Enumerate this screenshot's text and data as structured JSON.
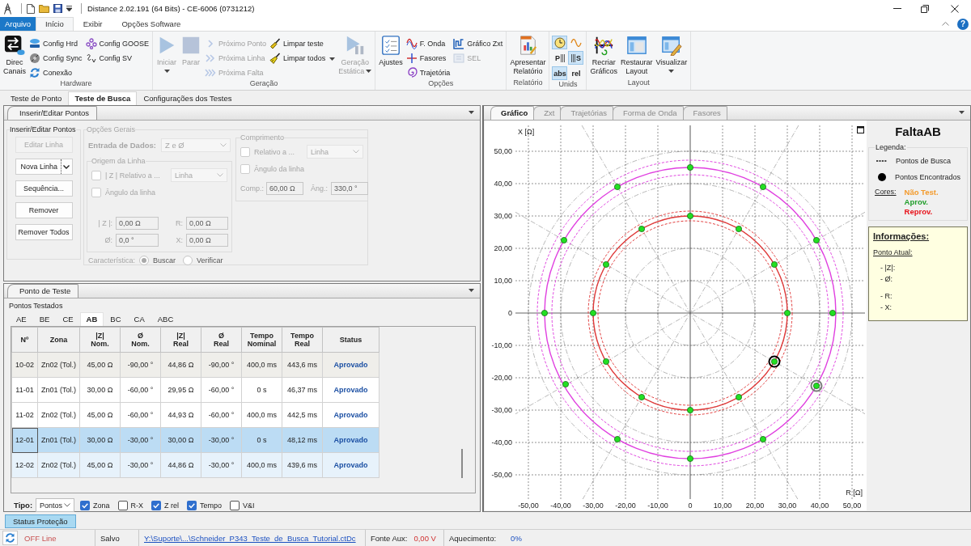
{
  "title_bar": {
    "title": "Distance 2.02.191 (64 Bits) - CE-6006 (0731212)"
  },
  "menu_bar": {
    "tabs": [
      {
        "label": "Arquivo",
        "kind": "file",
        "selected": false
      },
      {
        "label": "Início",
        "kind": "tab",
        "selected": true
      },
      {
        "label": "Exibir",
        "kind": "tab",
        "selected": false
      },
      {
        "label": "Opções Software",
        "kind": "tab",
        "selected": false
      }
    ],
    "help": "?"
  },
  "ribbon": [
    {
      "label": "Hardware",
      "columns": [
        {
          "kind": "large",
          "items": [
            {
              "label": "Direc\nCanais",
              "disabled": false
            }
          ]
        },
        {
          "kind": "stack",
          "items": [
            {
              "label": "Config Hrd",
              "disabled": false
            },
            {
              "label": "Config Sync",
              "disabled": false
            },
            {
              "label": "Conexão",
              "disabled": false
            }
          ]
        },
        {
          "kind": "stack",
          "items": [
            {
              "label": "Config GOOSE",
              "disabled": false
            },
            {
              "label": "Config SV",
              "disabled": false
            }
          ]
        }
      ]
    },
    {
      "label": "Geração",
      "columns": [
        {
          "kind": "large",
          "items": [
            {
              "label": "Iniciar",
              "disabled": true,
              "dropdown": true
            }
          ]
        },
        {
          "kind": "large",
          "items": [
            {
              "label": "Parar",
              "disabled": true
            }
          ]
        },
        {
          "kind": "stack",
          "items": [
            {
              "label": "Próximo Ponto",
              "disabled": true
            },
            {
              "label": "Próxima Linha",
              "disabled": true
            },
            {
              "label": "Próxima Falta",
              "disabled": true
            }
          ]
        },
        {
          "kind": "stack",
          "items": [
            {
              "label": "Limpar teste",
              "disabled": false
            },
            {
              "label": "Limpar todos",
              "disabled": false,
              "dropdown": true
            }
          ]
        },
        {
          "kind": "large",
          "items": [
            {
              "label": "Geração\nEstática",
              "disabled": true,
              "dropdown": true
            }
          ]
        }
      ]
    },
    {
      "label": "Opções",
      "columns": [
        {
          "kind": "large",
          "items": [
            {
              "label": "Ajustes",
              "disabled": false
            }
          ]
        },
        {
          "kind": "stack",
          "items": [
            {
              "label": "F. Onda",
              "disabled": false
            },
            {
              "label": "Fasores",
              "disabled": false
            },
            {
              "label": "Trajetória",
              "disabled": false
            }
          ]
        },
        {
          "kind": "stack",
          "items": [
            {
              "label": "Gráfico Zxt",
              "disabled": false
            },
            {
              "label": "SEL",
              "disabled": true
            }
          ]
        }
      ]
    },
    {
      "label": "Relatório",
      "columns": [
        {
          "kind": "large",
          "items": [
            {
              "label": "Apresentar\nRelatório",
              "disabled": false
            }
          ]
        }
      ]
    },
    {
      "label": "Unids",
      "columns": [
        {
          "kind": "toggles",
          "items": [
            {
              "selected": true
            },
            {
              "selected": false
            },
            {
              "label": "P",
              "selected": false
            },
            {
              "label": "S",
              "selected": true
            },
            {
              "label": "abs",
              "selected": true
            },
            {
              "label": "rel",
              "selected": false
            }
          ]
        }
      ]
    },
    {
      "label": "Layout",
      "columns": [
        {
          "kind": "large",
          "items": [
            {
              "label": "Recriar\nGráficos",
              "disabled": false
            }
          ]
        },
        {
          "kind": "large",
          "items": [
            {
              "label": "Restaurar\nLayout",
              "disabled": false
            }
          ]
        },
        {
          "kind": "large",
          "items": [
            {
              "label": "Visualizar",
              "disabled": false,
              "dropdown": true
            }
          ]
        }
      ]
    }
  ],
  "main_tabs": [
    {
      "label": "Teste de Ponto",
      "selected": false
    },
    {
      "label": "Teste de Busca",
      "selected": true
    },
    {
      "label": "Configurações dos Testes",
      "selected": false
    }
  ],
  "insert_panel": {
    "tab": "Inserir/Editar Pontos",
    "actions": {
      "label": "Inserir/Editar Pontos",
      "buttons": [
        {
          "label": "Editar Linha",
          "kind": "button",
          "disabled": true
        },
        {
          "label": "Nova Linha",
          "kind": "split",
          "disabled": false
        },
        {
          "label": "Sequência...",
          "kind": "button",
          "disabled": false
        },
        {
          "label": "Remover",
          "kind": "button",
          "disabled": false
        },
        {
          "label": "Remover Todos",
          "kind": "button",
          "disabled": false
        }
      ]
    },
    "options": {
      "label": "Opções Gerais",
      "disabled": true,
      "data_entry": {
        "label": "Entrada de Dados:",
        "value": "Z e Ø"
      },
      "origin": {
        "label": "Origem da Linha",
        "checks": [
          {
            "label": "| Z | Relativo a ...",
            "checked": false,
            "select": "Linha"
          },
          {
            "label": "Ângulo da linha",
            "checked": false
          }
        ],
        "fields": [
          {
            "label": "| Z |:",
            "value": "0,00 Ω"
          },
          {
            "label": "R:",
            "value": "0,00 Ω"
          },
          {
            "label": "Ø:",
            "value": "0,0 °"
          },
          {
            "label": "X:",
            "value": "0,00 Ω"
          }
        ]
      },
      "length": {
        "label": "Comprimento",
        "checks": [
          {
            "label": "Relativo a ...",
            "checked": false,
            "select": "Linha"
          },
          {
            "label": "Ângulo da linha",
            "checked": false
          }
        ],
        "fields": [
          {
            "label": "Comp.:",
            "value": "60,00 Ω"
          },
          {
            "label": "Âng.:",
            "value": "330,0 °"
          }
        ]
      },
      "characteristic": {
        "label": "Característica:",
        "options": [
          {
            "label": "Buscar",
            "selected": true
          },
          {
            "label": "Verificar",
            "selected": false
          }
        ]
      }
    }
  },
  "test_panel": {
    "tab": "Ponto de Teste",
    "title": "Pontos Testados",
    "fault_tabs": [
      {
        "label": "AE",
        "selected": false
      },
      {
        "label": "BE",
        "selected": false
      },
      {
        "label": "CE",
        "selected": false
      },
      {
        "label": "AB",
        "selected": true
      },
      {
        "label": "BC",
        "selected": false
      },
      {
        "label": "CA",
        "selected": false
      },
      {
        "label": "ABC",
        "selected": false
      }
    ],
    "table": {
      "columns": [
        "Nº",
        "Zona",
        "|Z|\nNom.",
        "Ø\nNom.",
        "|Z|\nReal",
        "Ø\nReal",
        "Tempo\nNominal",
        "Tempo\nReal",
        "Status"
      ],
      "rows": [
        {
          "cells": [
            "10-02",
            "Zn02 (Tol.)",
            "45,00 Ω",
            "-90,00 °",
            "44,86 Ω",
            "-90,00 °",
            "400,0 ms",
            "443,6 ms",
            "Aprovado"
          ],
          "selected": false,
          "hovered": false,
          "shaded": true
        },
        {
          "cells": [
            "11-01",
            "Zn01 (Tol.)",
            "30,00 Ω",
            "-60,00 °",
            "29,95 Ω",
            "-60,00 °",
            "0 s",
            "46,37 ms",
            "Aprovado"
          ],
          "selected": false,
          "hovered": false,
          "shaded": false
        },
        {
          "cells": [
            "11-02",
            "Zn02 (Tol.)",
            "45,00 Ω",
            "-60,00 °",
            "44,93 Ω",
            "-60,00 °",
            "400,0 ms",
            "442,5 ms",
            "Aprovado"
          ],
          "selected": false,
          "hovered": false,
          "shaded": false
        },
        {
          "cells": [
            "12-01",
            "Zn01 (Tol.)",
            "30,00 Ω",
            "-30,00 °",
            "30,00 Ω",
            "-30,00 °",
            "0 s",
            "48,12 ms",
            "Aprovado"
          ],
          "selected": true,
          "hovered": false,
          "shaded": false
        },
        {
          "cells": [
            "12-02",
            "Zn02 (Tol.)",
            "45,00 Ω",
            "-30,00 °",
            "44,86 Ω",
            "-30,00 °",
            "400,0 ms",
            "439,6 ms",
            "Aprovado"
          ],
          "selected": false,
          "hovered": true,
          "shaded": false
        }
      ]
    },
    "filter": {
      "label": "Tipo:",
      "value": "Pontos",
      "checks": [
        {
          "label": "Zona",
          "checked": true
        },
        {
          "label": "R-X",
          "checked": false
        },
        {
          "label": "Z rel",
          "checked": true
        },
        {
          "label": "Tempo",
          "checked": true
        },
        {
          "label": "V&I",
          "checked": false
        }
      ]
    }
  },
  "graph_panel": {
    "tabs": [
      {
        "label": "Gráfico",
        "selected": true
      },
      {
        "label": "Zxt",
        "selected": false
      },
      {
        "label": "Trajetórias",
        "selected": false
      },
      {
        "label": "Forma de Onda",
        "selected": false
      },
      {
        "label": "Fasores",
        "selected": false
      }
    ],
    "chart_data": {
      "type": "scatter",
      "xlabel": "R [Ω]",
      "ylabel": "X [Ω]",
      "xlim": [
        -54,
        54
      ],
      "ylim": [
        -57.5,
        58
      ],
      "grid": true,
      "xticks": [
        {
          "value": -50,
          "label": "-50,00"
        },
        {
          "value": -40,
          "label": "-40,00"
        },
        {
          "value": -30,
          "label": "-30,00"
        },
        {
          "value": -20,
          "label": "-20,00"
        },
        {
          "value": -10,
          "label": "-10,00"
        },
        {
          "value": 0,
          "label": "0"
        },
        {
          "value": 10,
          "label": "10,00"
        },
        {
          "value": 20,
          "label": "20,00"
        },
        {
          "value": 30,
          "label": "30,00"
        },
        {
          "value": 40,
          "label": "40,00"
        },
        {
          "value": 50,
          "label": "50,00"
        }
      ],
      "yticks": [
        {
          "value": 50,
          "label": "50,00"
        },
        {
          "value": 40,
          "label": "40,00"
        },
        {
          "value": 30,
          "label": "30,00"
        },
        {
          "value": 20,
          "label": "20,00"
        },
        {
          "value": 10,
          "label": "10,00"
        },
        {
          "value": 0,
          "label": "0"
        },
        {
          "value": -10,
          "label": "-10,00"
        },
        {
          "value": -20,
          "label": "-20,00"
        },
        {
          "value": -30,
          "label": "-30,00"
        },
        {
          "value": -40,
          "label": "-40,00"
        },
        {
          "value": -50,
          "label": "-50,00"
        }
      ],
      "x": [
        0,
        15,
        26,
        30,
        26,
        15,
        0,
        -15,
        -26,
        -30,
        -26,
        -15,
        0,
        22.5,
        39,
        44,
        39,
        22.5,
        0,
        -22.5,
        -38.5,
        -45,
        -39,
        -22.5
      ],
      "series": [
        {
          "name": "Pontos Encontrados",
          "color": "#22e022",
          "values": [
            30,
            26,
            15,
            0,
            -15,
            -26,
            -30,
            -26,
            -15,
            0,
            15,
            26,
            45,
            39,
            22.5,
            0,
            -22.5,
            -39,
            -45,
            -39,
            -22,
            0,
            22.5,
            39
          ]
        },
        {
          "color": "#000000",
          "values": [
            null,
            null,
            null,
            null,
            -15,
            null,
            null,
            null,
            null,
            null,
            null,
            null,
            null,
            null,
            null,
            null,
            null,
            null,
            null,
            null,
            null,
            null,
            null,
            null
          ]
        },
        {
          "color": "#7a7a7a",
          "values": [
            null,
            null,
            null,
            null,
            null,
            null,
            null,
            null,
            null,
            null,
            null,
            null,
            null,
            null,
            null,
            null,
            -22.5,
            null,
            null,
            null,
            null,
            null,
            null,
            null
          ]
        }
      ]
    },
    "legend": {
      "title": "FaltaAB",
      "label": "Legenda:",
      "entries": [
        {
          "label": "Pontos de Busca"
        }
      ],
      "colors_label": "Cores:",
      "colors": [
        {
          "label": "Não Test.",
          "color": "#f39a2c"
        },
        {
          "label": "Aprov.",
          "color": "#1f9e2a"
        },
        {
          "label": "Reprov.",
          "color": "#e8141c"
        }
      ]
    },
    "info": {
      "title": "Informações:",
      "subtitle": "Ponto Atual:",
      "groups": [
        [
          "- |Z|:",
          "- Ø:"
        ],
        [
          "- R:",
          "- X:"
        ]
      ]
    }
  },
  "bottom_tabs": [
    {
      "label": "Status Proteção",
      "selected": true
    }
  ],
  "status_bar": {
    "connection": {
      "label": "OFF Line",
      "online": false
    },
    "saved": "Salvo",
    "file": "Y:\\Suporte\\...\\Schneider_P343_Teste_de_Busca_Tutorial.ctDc",
    "aux": {
      "label": "Fonte Aux:",
      "value": "0,00 V"
    },
    "heating": {
      "label": "Aquecimento:",
      "value": "0%"
    }
  }
}
